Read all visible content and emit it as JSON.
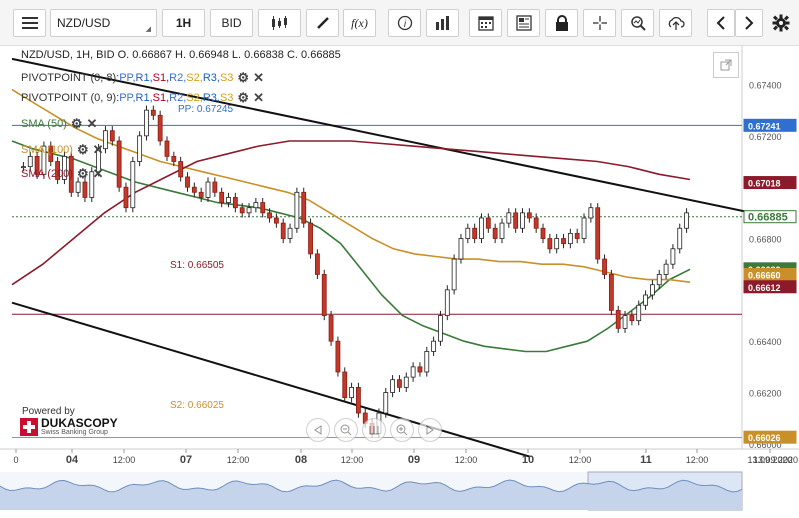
{
  "toolbar": {
    "symbol": "NZD/USD",
    "timeframe": "1H",
    "price_type": "BID",
    "items": [
      "menu-icon",
      "candles-icon",
      "draw-icon",
      "fx-icon",
      "info-icon",
      "bars-icon",
      "calendar-icon",
      "news-icon",
      "lock-icon",
      "crosshair-icon",
      "zoom-icon",
      "upload-icon",
      "back-icon",
      "forward-icon",
      "settings-icon"
    ]
  },
  "header": {
    "ohlc": "NZD/USD, 1H, BID   O. 0.66867 H. 0.66948 L. 0.66838 C. 0.66885"
  },
  "legend": [
    {
      "label": "PIVOTPOINT (0, 8)",
      "color": "#333333",
      "parts": [
        "PP",
        "R1",
        "S1",
        "R2",
        "S2",
        "R3",
        "S3"
      ]
    },
    {
      "label": "PIVOTPOINT (0, 9)",
      "color": "#333333",
      "parts": [
        "PP",
        "R1",
        "S1",
        "R2",
        "S2",
        "R3",
        "S3"
      ]
    },
    {
      "label": "SMA (50)",
      "color": "#3a7a3a"
    },
    {
      "label": "SMA (100)",
      "color": "#c9902a"
    },
    {
      "label": "SMA (200)",
      "color": "#8b1a2b"
    }
  ],
  "pp_parts_colors": [
    "#3b6fd1",
    "#1a5fc2",
    "#b00020",
    "#3b6fd1",
    "#d4a017",
    "#1a5fc2",
    "#d4a017"
  ],
  "pivot_labels": {
    "pp": "PP: 0.67245",
    "s1": "S1: 0.66505",
    "s2": "S2: 0.66025"
  },
  "branding": {
    "powered_by": "Powered by",
    "name": "DUKASCOPY",
    "sub": "Swiss Banking Group"
  },
  "date_label": "13.09.2020",
  "colors": {
    "sma50": "#3a7a3a",
    "sma100": "#c9902a",
    "sma200": "#8b1a2b",
    "up": "#ffffff",
    "down": "#c0392b",
    "channel": "#111111"
  },
  "chart_data": {
    "type": "candlestick",
    "symbol": "NZD/USD",
    "timeframe": "1H",
    "ylim": [
      0.6598,
      0.6755
    ],
    "y_ticks": [
      0.674,
      0.672,
      0.668,
      0.664,
      0.662,
      0.66
    ],
    "y_tick_labels": [
      "0.67400",
      "0.67241",
      "0.67018",
      "0.66885",
      "0.66800",
      "0.66682",
      "0.66660",
      "0.66612",
      "0.66400",
      "0.66200",
      "0.66026",
      "0.66000"
    ],
    "x_tick_labels": [
      "0",
      "04",
      "12:00",
      "07",
      "12:00",
      "08",
      "12:00",
      "09",
      "12:00",
      "10",
      "12:00",
      "11",
      "12:00",
      "13.09.2020"
    ],
    "horizontal_levels": [
      {
        "name": "R-level",
        "value": 0.67241,
        "color": "#2f6fd0"
      },
      {
        "name": "S1",
        "value": 0.66505,
        "color": "#8b1a2b"
      },
      {
        "name": "S2",
        "value": 0.66025,
        "color": "#c9902a"
      },
      {
        "name": "last",
        "value": 0.66885,
        "color": "#3a7a3a"
      }
    ],
    "price_badges": [
      {
        "value": "0.67241",
        "bg": "#2f6fd0",
        "fg": "#ffffff"
      },
      {
        "value": "0.67018",
        "bg": "#8b1a2b",
        "fg": "#ffffff"
      },
      {
        "value": "0.66885",
        "bg": "#ffffff",
        "fg": "#3a7a3a",
        "border": "#3a7a3a"
      },
      {
        "value": "0.66682",
        "bg": "#3a7a3a",
        "fg": "#ffffff"
      },
      {
        "value": "0.66660",
        "bg": "#c9902a",
        "fg": "#ffffff"
      },
      {
        "value": "0.66612",
        "bg": "#8b1a2b",
        "fg": "#ffffff"
      },
      {
        "value": "0.66026",
        "bg": "#c9902a",
        "fg": "#ffffff"
      }
    ],
    "candles_close": [
      0.6708,
      0.6712,
      0.6705,
      0.6716,
      0.671,
      0.6703,
      0.6712,
      0.6698,
      0.6702,
      0.6696,
      0.6706,
      0.6715,
      0.6722,
      0.6718,
      0.67,
      0.6692,
      0.671,
      0.672,
      0.673,
      0.6728,
      0.6718,
      0.6712,
      0.671,
      0.6704,
      0.67,
      0.6698,
      0.6696,
      0.6702,
      0.6698,
      0.6694,
      0.6696,
      0.6692,
      0.669,
      0.6692,
      0.6694,
      0.669,
      0.6688,
      0.6686,
      0.668,
      0.6684,
      0.6698,
      0.6686,
      0.6674,
      0.6666,
      0.665,
      0.664,
      0.6628,
      0.6618,
      0.6622,
      0.6612,
      0.6608,
      0.6604,
      0.6612,
      0.662,
      0.6625,
      0.6622,
      0.6626,
      0.663,
      0.6628,
      0.6636,
      0.664,
      0.665,
      0.666,
      0.6672,
      0.668,
      0.6684,
      0.668,
      0.6688,
      0.6684,
      0.668,
      0.6686,
      0.669,
      0.6684,
      0.669,
      0.6688,
      0.6684,
      0.668,
      0.6676,
      0.668,
      0.6678,
      0.6682,
      0.668,
      0.6688,
      0.6692,
      0.6672,
      0.6666,
      0.6652,
      0.6645,
      0.665,
      0.6648,
      0.6654,
      0.6658,
      0.6662,
      0.6666,
      0.667,
      0.6676,
      0.6684,
      0.669
    ],
    "series": [
      {
        "name": "SMA (50)",
        "values": [
          0.6718,
          0.6715,
          0.6713,
          0.6711,
          0.6708,
          0.6705,
          0.6702,
          0.67,
          0.6698,
          0.6696,
          0.6694,
          0.6693,
          0.6692,
          0.669,
          0.6688,
          0.6684,
          0.6678,
          0.6668,
          0.6658,
          0.665,
          0.6646,
          0.6643,
          0.664,
          0.6638,
          0.6637,
          0.6636,
          0.6636,
          0.6638,
          0.664,
          0.6645,
          0.6651,
          0.6657,
          0.6664,
          0.6668
        ]
      },
      {
        "name": "SMA (100)",
        "values": [
          0.6738,
          0.6733,
          0.6728,
          0.6723,
          0.6719,
          0.6716,
          0.6713,
          0.671,
          0.6708,
          0.6706,
          0.6704,
          0.6702,
          0.67,
          0.6698,
          0.6695,
          0.669,
          0.6685,
          0.668,
          0.6676,
          0.6674,
          0.6673,
          0.6672,
          0.6672,
          0.6671,
          0.6671,
          0.667,
          0.667,
          0.6669,
          0.6667,
          0.6665,
          0.6664,
          0.6664,
          0.6663
        ]
      },
      {
        "name": "SMA (200)",
        "values": [
          0.6662,
          0.667,
          0.668,
          0.669,
          0.6698,
          0.6704,
          0.671,
          0.6713,
          0.6716,
          0.6718,
          0.6718,
          0.6718,
          0.6717,
          0.6716,
          0.6715,
          0.6714,
          0.6713,
          0.6712,
          0.6711,
          0.671,
          0.6708,
          0.6705,
          0.6703
        ]
      }
    ],
    "channel_lines": [
      {
        "from": [
          0,
          0.675
        ],
        "to": [
          1,
          0.669
        ]
      },
      {
        "from": [
          0,
          0.6655
        ],
        "to": [
          0.7,
          0.6595
        ]
      }
    ]
  }
}
